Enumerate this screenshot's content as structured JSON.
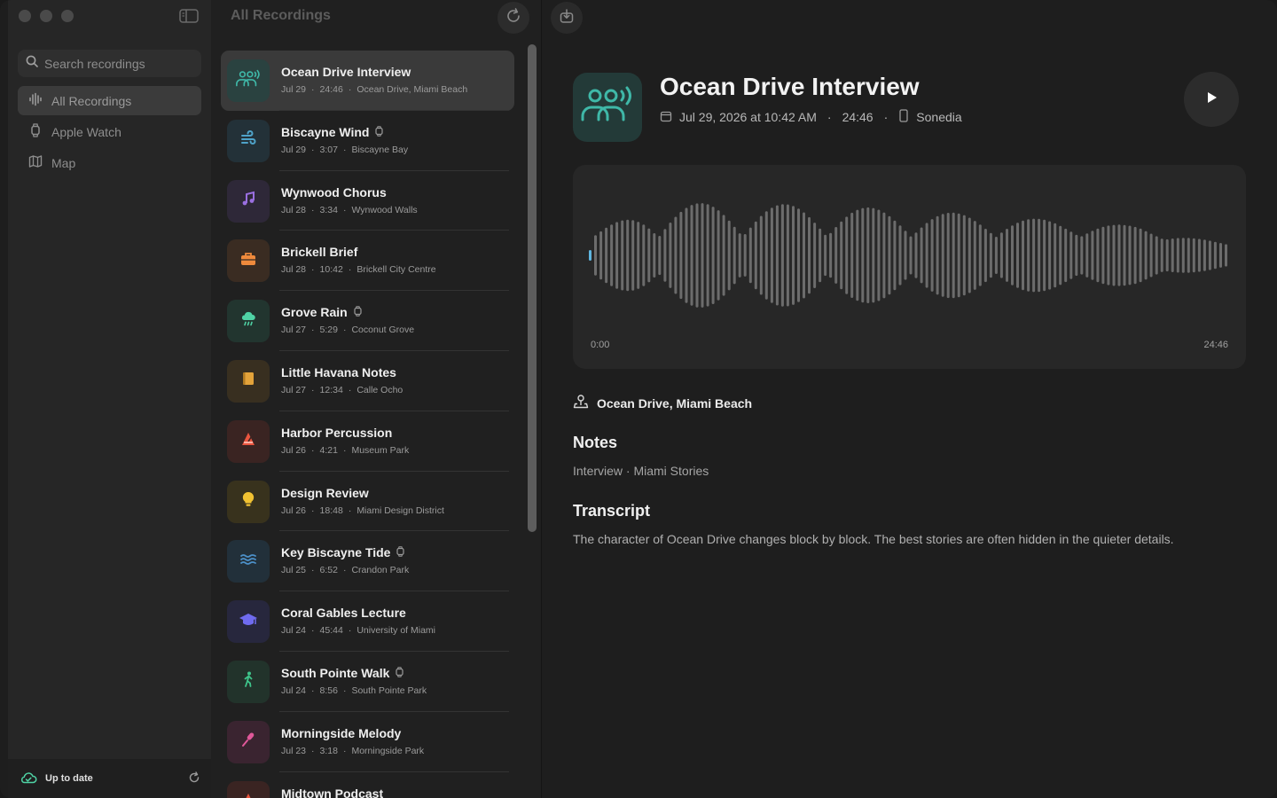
{
  "sidebar": {
    "search_placeholder": "Search recordings",
    "items": [
      {
        "label": "All Recordings",
        "icon": "waveform-icon",
        "active": true
      },
      {
        "label": "Apple Watch",
        "icon": "watch-icon"
      },
      {
        "label": "Map",
        "icon": "map-icon"
      }
    ],
    "footer_status": "Up to date"
  },
  "list": {
    "header": "All Recordings",
    "separator": "·",
    "recordings": [
      {
        "title": "Ocean Drive Interview",
        "date": "Jul 29",
        "duration": "24:46",
        "place": "Ocean Drive, Miami Beach",
        "icon": "people-waves-icon",
        "color": "#3fb8a8",
        "bg": "#2a4240",
        "watch": false
      },
      {
        "title": "Biscayne Wind",
        "date": "Jul 29",
        "duration": "3:07",
        "place": "Biscayne Bay",
        "icon": "wind-icon",
        "color": "#4fa3c9",
        "bg": "#233138",
        "watch": true
      },
      {
        "title": "Wynwood Chorus",
        "date": "Jul 28",
        "duration": "3:34",
        "place": "Wynwood Walls",
        "icon": "music-note-icon",
        "color": "#9a6fe0",
        "bg": "#2e2838",
        "watch": false
      },
      {
        "title": "Brickell Brief",
        "date": "Jul 28",
        "duration": "10:42",
        "place": "Brickell City Centre",
        "icon": "briefcase-icon",
        "color": "#ef8a3c",
        "bg": "#3a2c22",
        "watch": false
      },
      {
        "title": "Grove Rain",
        "date": "Jul 27",
        "duration": "5:29",
        "place": "Coconut Grove",
        "icon": "cloud-rain-icon",
        "color": "#4fd3a5",
        "bg": "#22352f",
        "watch": true
      },
      {
        "title": "Little Havana Notes",
        "date": "Jul 27",
        "duration": "12:34",
        "place": "Calle Ocho",
        "icon": "book-icon",
        "color": "#e3a33a",
        "bg": "#382f20",
        "watch": false
      },
      {
        "title": "Harbor Percussion",
        "date": "Jul 26",
        "duration": "4:21",
        "place": "Museum Park",
        "icon": "metronome-icon",
        "color": "#e9553f",
        "bg": "#3a2422",
        "watch": false
      },
      {
        "title": "Design Review",
        "date": "Jul 26",
        "duration": "18:48",
        "place": "Miami Design District",
        "icon": "lightbulb-icon",
        "color": "#f1c232",
        "bg": "#38321d",
        "watch": false
      },
      {
        "title": "Key Biscayne Tide",
        "date": "Jul 25",
        "duration": "6:52",
        "place": "Crandon Park",
        "icon": "water-waves-icon",
        "color": "#4c90c8",
        "bg": "#22303a",
        "watch": true
      },
      {
        "title": "Coral Gables Lecture",
        "date": "Jul 24",
        "duration": "45:44",
        "place": "University of Miami",
        "icon": "graduation-cap-icon",
        "color": "#6f6bef",
        "bg": "#27273d",
        "watch": false
      },
      {
        "title": "South Pointe Walk",
        "date": "Jul 24",
        "duration": "8:56",
        "place": "South Pointe Park",
        "icon": "walking-figure-icon",
        "color": "#3ec48a",
        "bg": "#22332b",
        "watch": true
      },
      {
        "title": "Morningside Melody",
        "date": "Jul 23",
        "duration": "3:18",
        "place": "Morningside Park",
        "icon": "microphone-icon",
        "color": "#e0589a",
        "bg": "#3a2430",
        "watch": false
      },
      {
        "title": "Midtown Podcast",
        "date": "",
        "duration": "",
        "place": "",
        "icon": "podcast-icon",
        "color": "#e9553f",
        "bg": "#3a2422",
        "watch": false
      }
    ]
  },
  "detail": {
    "title": "Ocean Drive Interview",
    "date": "Jul 29, 2026 at 10:42 AM",
    "duration": "24:46",
    "device": "Sonedia",
    "meta_sep": "·",
    "time_start": "0:00",
    "time_end": "24:46",
    "playback_progress": 0.0,
    "location": "Ocean Drive, Miami Beach",
    "notes_heading": "Notes",
    "notes": "Interview · Miami Stories",
    "transcript_heading": "Transcript",
    "transcript": "The character of Ocean Drive changes block by block. The best stories are often hidden in the quieter details.",
    "accent": "#3fb8a8"
  }
}
